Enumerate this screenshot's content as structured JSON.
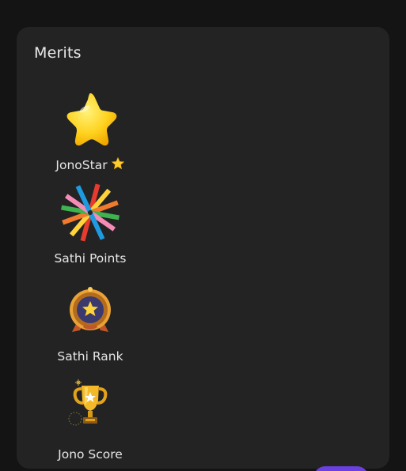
{
  "merits": {
    "title": "Merits",
    "items": [
      {
        "label": "JonoStar",
        "icon": "star-icon",
        "trailing_icon": "star-emoji-icon"
      },
      {
        "label": "Sathi Points",
        "icon": "starburst-icon"
      },
      {
        "label": "Sathi Rank",
        "icon": "rank-medal-icon"
      },
      {
        "label": "Jono Score",
        "icon": "trophy-icon"
      }
    ]
  },
  "colors": {
    "page_bg": "#141414",
    "card_bg": "#232323",
    "text": "#e6e6e6",
    "accent_purple": "#6b3fe0",
    "star_yellow": "#ffd43b"
  }
}
